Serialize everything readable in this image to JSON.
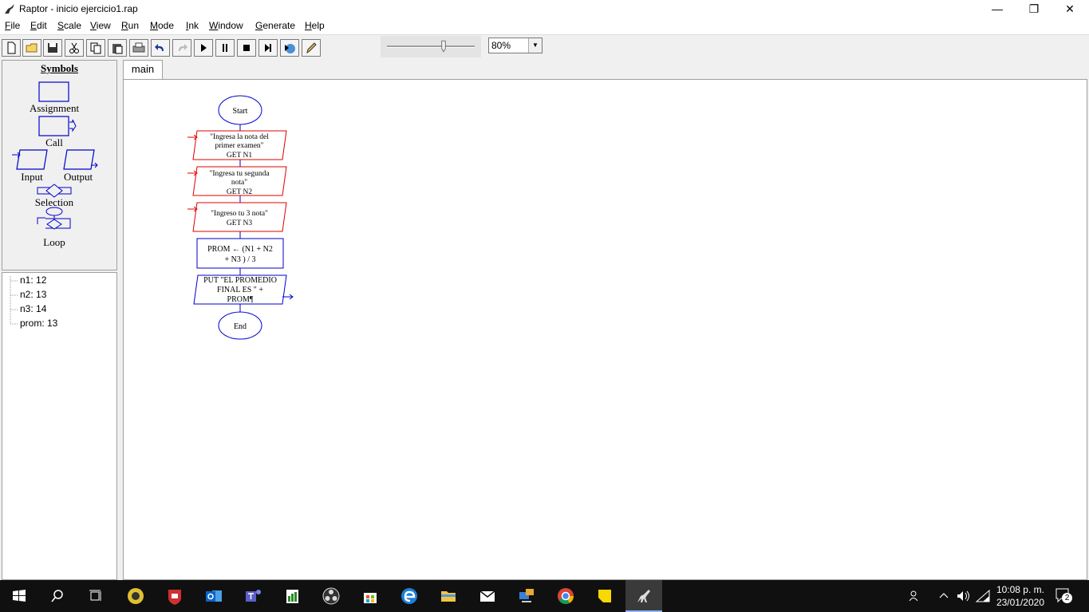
{
  "window": {
    "title": "Raptor - inicio ejercicio1.rap",
    "minimize_glyph": "—",
    "restore_glyph": "❐",
    "close_glyph": "✕"
  },
  "menu": [
    "File",
    "Edit",
    "Scale",
    "View",
    "Run",
    "Mode",
    "Ink",
    "Window",
    "Generate",
    "Help"
  ],
  "toolbar": {
    "buttons": [
      "new",
      "open",
      "save",
      "cut",
      "copy",
      "paste",
      "print",
      "undo",
      "redo",
      "run",
      "pause",
      "stop",
      "step",
      "reset",
      "pen"
    ],
    "speed_level": 0.65,
    "zoom": "80%"
  },
  "symbols": {
    "title": "Symbols",
    "assignment": "Assignment",
    "call": "Call",
    "input": "Input",
    "output": "Output",
    "selection": "Selection",
    "loop": "Loop"
  },
  "variables": [
    "n1: 12",
    "n2: 13",
    "n3: 14",
    "prom: 13"
  ],
  "tabs": [
    "main"
  ],
  "flowchart": {
    "start": "Start",
    "input1_prompt": [
      "\"Ingresa la nota del",
      "primer examen\""
    ],
    "input1_get": "GET N1",
    "input2_prompt": [
      "\"Ingresa tu segunda",
      "nota\""
    ],
    "input2_get": "GET N2",
    "input3_prompt": [
      "\"Ingreso tu 3 nota\""
    ],
    "input3_get": "GET N3",
    "assign": [
      "PROM ← (N1 + N2",
      "+ N3 ) / 3"
    ],
    "output": [
      "PUT \"EL PROMEDIO",
      "FINAL ES \" +",
      "PROM¶"
    ],
    "end": "End"
  },
  "taskbar": {
    "time": "10:08 p. m.",
    "date": "23/01/2020",
    "notifications": "2"
  },
  "colors": {
    "flow_blue": "#0000cc",
    "input_red": "#e00000"
  }
}
